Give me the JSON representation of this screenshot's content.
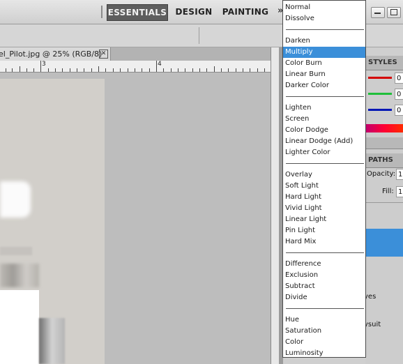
{
  "workspace": {
    "buttons": [
      {
        "label": "ESSENTIALS",
        "active": true
      },
      {
        "label": "DESIGN",
        "active": false
      },
      {
        "label": "PAINTING",
        "active": false
      }
    ],
    "more_icon": "chevron-right-double-icon"
  },
  "document": {
    "tab_title": "el_Pilot.jpg @ 25% (RGB/8)",
    "close_symbol": "✕"
  },
  "ruler": {
    "labels": [
      "3",
      "4"
    ]
  },
  "right_panel": {
    "styles_tab": "STYLES",
    "paths_tab": "PATHS",
    "color_values": [
      "0",
      "0",
      "0"
    ],
    "opacity_label": "Opacity:",
    "opacity_value": "1",
    "fill_label": "Fill:",
    "fill_value": "1",
    "layer_text_1": "yes",
    "layer_text_2": "ysuit",
    "colors": {
      "red": "#d40000",
      "green": "#1fbf3a",
      "blue": "#0016b5",
      "selection": "#3b8fd9"
    }
  },
  "blend_mode_menu": {
    "selected": "Multiply",
    "groups": [
      [
        "Normal",
        "Dissolve"
      ],
      [
        "Darken",
        "Multiply",
        "Color Burn",
        "Linear Burn",
        "Darker Color"
      ],
      [
        "Lighten",
        "Screen",
        "Color Dodge",
        "Linear Dodge (Add)",
        "Lighter Color"
      ],
      [
        "Overlay",
        "Soft Light",
        "Hard Light",
        "Vivid Light",
        "Linear Light",
        "Pin Light",
        "Hard Mix"
      ],
      [
        "Difference",
        "Exclusion",
        "Subtract",
        "Divide"
      ],
      [
        "Hue",
        "Saturation",
        "Color",
        "Luminosity"
      ]
    ]
  }
}
